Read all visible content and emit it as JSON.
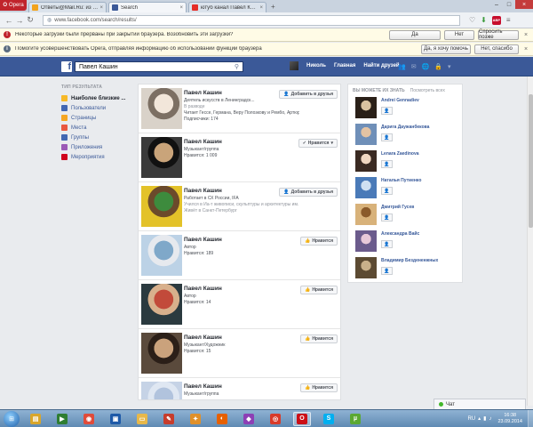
{
  "browser": {
    "menu_label": "Opera",
    "tabs": [
      {
        "label": "Ответы@Mail.Ru: из чего сделан...",
        "active": false
      },
      {
        "label": "Search",
        "active": true
      },
      {
        "label": "ютуб канал Павел Кашин",
        "active": false
      }
    ],
    "address": "www.facebook.com/search/results/"
  },
  "notifications": [
    {
      "text": "Некоторые загрузки были прерваны при закрытии браузера. Возобновить эти загрузки?",
      "buttons": [
        "Да",
        "Нет",
        "Спросить позже"
      ]
    },
    {
      "text": "Помогите усовершенствовать Opera, отправляя информацию об использовании функций браузера",
      "buttons": [
        "Да, я хочу помочь",
        "Нет, спасибо"
      ]
    }
  ],
  "facebook": {
    "search_value": "Павел Кашин",
    "nav": {
      "user": "Николь",
      "home": "Главная",
      "find_friends": "Найти друзей"
    }
  },
  "sidebar": {
    "heading": "ТИП РЕЗУЛЬТАТА",
    "items": [
      {
        "label": "Наиболее близкие ...",
        "icon": "star-icon",
        "color": "#f7b928",
        "selected": true
      },
      {
        "label": "Пользователи",
        "icon": "people-icon",
        "color": "#4267b2",
        "selected": false
      },
      {
        "label": "Страницы",
        "icon": "flag-icon",
        "color": "#f5a623",
        "selected": false
      },
      {
        "label": "Места",
        "icon": "pin-icon",
        "color": "#e9573f",
        "selected": false
      },
      {
        "label": "Группы",
        "icon": "groups-icon",
        "color": "#4267b2",
        "selected": false
      },
      {
        "label": "Приложения",
        "icon": "apps-icon",
        "color": "#9b59b6",
        "selected": false
      },
      {
        "label": "Мероприятия",
        "icon": "calendar-icon",
        "color": "#d0021b",
        "selected": false
      }
    ]
  },
  "results": [
    {
      "name": "Павел Кашин",
      "lines": [
        "Деятель искусств в Ленинградск...",
        "В разводе",
        "Читает Гессе, Германа, Веру Полозкову и Рембо, Артюр",
        "Подписчики: 174"
      ],
      "muted": [
        false,
        true,
        false,
        false
      ],
      "button": "Добавить в друзья",
      "button_icon": "add-friend-icon",
      "photo": [
        "#d9d2c9",
        "#f2e6da",
        "#7c6f63"
      ]
    },
    {
      "name": "Павел Кашин",
      "lines": [
        "Музыкант/группа",
        "Нравится: 1 009"
      ],
      "muted": [
        false,
        false
      ],
      "button": "Нравится",
      "button_icon": "check-icon",
      "photo": [
        "#3a3a3a",
        "#c9a47a",
        "#111111"
      ]
    },
    {
      "name": "Павел Кашин",
      "lines": [
        "Работает в СХ России, IFA",
        "Учился в Иа-т живописи, скульптуры и архитектуры им. И.Е. Р...",
        "Живёт в Санкт-Петербург"
      ],
      "muted": [
        false,
        true,
        true
      ],
      "button": "Добавить в друзья",
      "button_icon": "add-friend-icon",
      "photo": [
        "#e3c229",
        "#3d8b3d",
        "#6b4a2b"
      ]
    },
    {
      "name": "Павел Кашин",
      "lines": [
        "Автор",
        "Нравится: 189"
      ],
      "muted": [
        false,
        false
      ],
      "button": "Нравится",
      "button_icon": "like-icon",
      "photo": [
        "#bcd2e6",
        "#7fa8c9",
        "#e6e9ee"
      ]
    },
    {
      "name": "Павел Кашин",
      "lines": [
        "Автор",
        "Нравится: 14"
      ],
      "muted": [
        false,
        false
      ],
      "button": "Нравится",
      "button_icon": "like-icon",
      "photo": [
        "#2b3a3f",
        "#c24a3a",
        "#d8b08c"
      ]
    },
    {
      "name": "Павел Кашин",
      "lines": [
        "Музыкант/Художник",
        "Нравится: 15"
      ],
      "muted": [
        false,
        false
      ],
      "button": "Нравится",
      "button_icon": "like-icon",
      "photo": [
        "#5a4a3c",
        "#caa27c",
        "#2b1f18"
      ]
    },
    {
      "name": "Павел Кашин",
      "lines": [
        "Музыкант/группа"
      ],
      "muted": [
        false
      ],
      "button": "Нравится",
      "button_icon": "like-icon",
      "photo": [
        "#c6d3e6",
        "#b1c3dd",
        "#dfe7f2"
      ]
    }
  ],
  "suggestions": {
    "heading": "ВЫ МОЖЕТЕ ИХ ЗНАТЬ",
    "see_all": "Посмотреть всех",
    "people": [
      {
        "name": "Andrei Gennadiev",
        "photo": [
          "#2a2018",
          "#d9c2a0"
        ]
      },
      {
        "name": "Дарига Даужанбекова",
        "photo": [
          "#6f8fb8",
          "#e3c3a3"
        ]
      },
      {
        "name": "Lenara Zaedinova",
        "photo": [
          "#3a2a22",
          "#f0d6c0"
        ]
      },
      {
        "name": "Наталья Путиенко",
        "photo": [
          "#4a7ab8",
          "#cfe0f2"
        ]
      },
      {
        "name": "Дмитрий Гусев",
        "photo": [
          "#d8b27a",
          "#8a5a2a"
        ]
      },
      {
        "name": "Александра Вайс",
        "photo": [
          "#6b5b8c",
          "#e8c8d8"
        ]
      },
      {
        "name": "Владимир Бездененжных",
        "photo": [
          "#5c4a32",
          "#c9b08a"
        ]
      }
    ]
  },
  "chat": {
    "label": "Чат"
  },
  "taskbar": {
    "apps": [
      {
        "icon": "explorer-icon",
        "color": "#d9a62b",
        "glyph": "▤",
        "active": false
      },
      {
        "icon": "player-icon",
        "color": "#2e7d32",
        "glyph": "▶",
        "active": false
      },
      {
        "icon": "chrome-icon",
        "color": "#e04b3a",
        "glyph": "◉",
        "active": false
      },
      {
        "icon": "media-icon",
        "color": "#1e5aa8",
        "glyph": "▣",
        "active": false
      },
      {
        "icon": "folder-icon",
        "color": "#e8b84a",
        "glyph": "▭",
        "active": false
      },
      {
        "icon": "paint-icon",
        "color": "#c73c2c",
        "glyph": "✎",
        "active": false
      },
      {
        "icon": "app-icon",
        "color": "#e0902a",
        "glyph": "✦",
        "active": false
      },
      {
        "icon": "firefox-icon",
        "color": "#e66000",
        "glyph": "◐",
        "active": false
      },
      {
        "icon": "game-icon",
        "color": "#8d3fb5",
        "glyph": "◆",
        "active": false
      },
      {
        "icon": "media-player-icon",
        "color": "#d83b2a",
        "glyph": "◎",
        "active": false
      },
      {
        "icon": "opera-icon",
        "color": "#cc0f16",
        "glyph": "O",
        "active": true
      },
      {
        "icon": "skype-icon",
        "color": "#00aff0",
        "glyph": "S",
        "active": false
      },
      {
        "icon": "torrent-icon",
        "color": "#5ba833",
        "glyph": "µ",
        "active": false
      }
    ],
    "lang": "RU",
    "time": "16:38",
    "date": "23.09.2014"
  }
}
